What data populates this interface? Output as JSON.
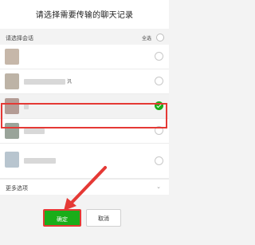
{
  "header": {
    "title": "请选择需要传输的聊天记录"
  },
  "section": {
    "label": "请选择会话",
    "select_all": "全选"
  },
  "chats": [
    {
      "name": "",
      "selected": false,
      "avatar_color": "#c6b7a9"
    },
    {
      "name": "汎",
      "selected": false,
      "avatar_color": "#bdb3a6"
    },
    {
      "name": "",
      "selected": true,
      "avatar_color": "#b49c95"
    },
    {
      "name": "",
      "selected": false,
      "avatar_color": "#9aa49a"
    },
    {
      "name": "",
      "selected": false,
      "avatar_color": "#b8c5cf"
    }
  ],
  "more": {
    "label": "更多选项"
  },
  "buttons": {
    "confirm": "确定",
    "cancel": "取消"
  },
  "colors": {
    "accent": "#1aad19",
    "annotation": "#e53935"
  }
}
